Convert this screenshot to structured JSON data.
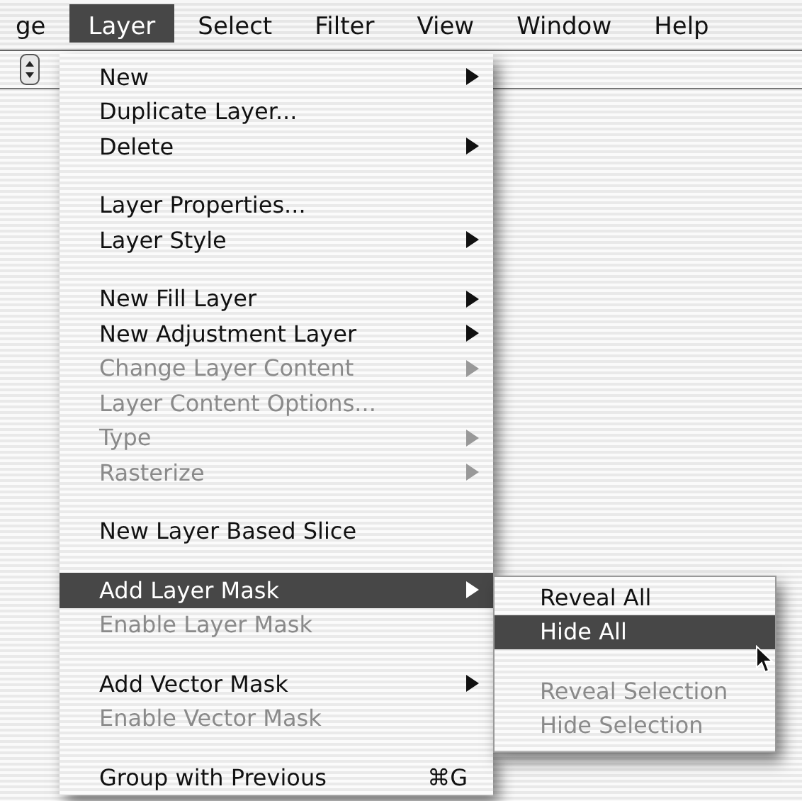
{
  "menubar": [
    {
      "label": "ge",
      "selected": false
    },
    {
      "label": "Layer",
      "selected": true
    },
    {
      "label": "Select",
      "selected": false
    },
    {
      "label": "Filter",
      "selected": false
    },
    {
      "label": "View",
      "selected": false
    },
    {
      "label": "Window",
      "selected": false
    },
    {
      "label": "Help",
      "selected": false
    }
  ],
  "menu": {
    "items": [
      {
        "kind": "item",
        "label": "New",
        "disabled": false,
        "submenu": true,
        "selected": false
      },
      {
        "kind": "item",
        "label": "Duplicate Layer...",
        "disabled": false,
        "submenu": false,
        "selected": false
      },
      {
        "kind": "item",
        "label": "Delete",
        "disabled": false,
        "submenu": true,
        "selected": false
      },
      {
        "kind": "separator"
      },
      {
        "kind": "item",
        "label": "Layer Properties...",
        "disabled": false,
        "submenu": false,
        "selected": false
      },
      {
        "kind": "item",
        "label": "Layer Style",
        "disabled": false,
        "submenu": true,
        "selected": false
      },
      {
        "kind": "separator"
      },
      {
        "kind": "item",
        "label": "New Fill Layer",
        "disabled": false,
        "submenu": true,
        "selected": false
      },
      {
        "kind": "item",
        "label": "New Adjustment Layer",
        "disabled": false,
        "submenu": true,
        "selected": false
      },
      {
        "kind": "item",
        "label": "Change Layer Content",
        "disabled": true,
        "submenu": true,
        "selected": false
      },
      {
        "kind": "item",
        "label": "Layer Content Options...",
        "disabled": true,
        "submenu": false,
        "selected": false
      },
      {
        "kind": "item",
        "label": "Type",
        "disabled": true,
        "submenu": true,
        "selected": false
      },
      {
        "kind": "item",
        "label": "Rasterize",
        "disabled": true,
        "submenu": true,
        "selected": false
      },
      {
        "kind": "separator"
      },
      {
        "kind": "item",
        "label": "New Layer Based Slice",
        "disabled": false,
        "submenu": false,
        "selected": false
      },
      {
        "kind": "separator"
      },
      {
        "kind": "item",
        "label": "Add Layer Mask",
        "disabled": false,
        "submenu": true,
        "selected": true
      },
      {
        "kind": "item",
        "label": "Enable Layer Mask",
        "disabled": true,
        "submenu": false,
        "selected": false
      },
      {
        "kind": "separator"
      },
      {
        "kind": "item",
        "label": "Add Vector Mask",
        "disabled": false,
        "submenu": true,
        "selected": false
      },
      {
        "kind": "item",
        "label": "Enable Vector Mask",
        "disabled": true,
        "submenu": false,
        "selected": false
      },
      {
        "kind": "separator"
      },
      {
        "kind": "item",
        "label": "Group with Previous",
        "disabled": false,
        "submenu": false,
        "selected": false,
        "shortcut": "⌘G"
      }
    ]
  },
  "submenu": {
    "items": [
      {
        "kind": "item",
        "label": "Reveal All",
        "disabled": false,
        "selected": false
      },
      {
        "kind": "item",
        "label": "Hide All",
        "disabled": false,
        "selected": true
      },
      {
        "kind": "separator"
      },
      {
        "kind": "item",
        "label": "Reveal Selection",
        "disabled": true,
        "selected": false
      },
      {
        "kind": "item",
        "label": "Hide Selection",
        "disabled": true,
        "selected": false
      }
    ]
  }
}
